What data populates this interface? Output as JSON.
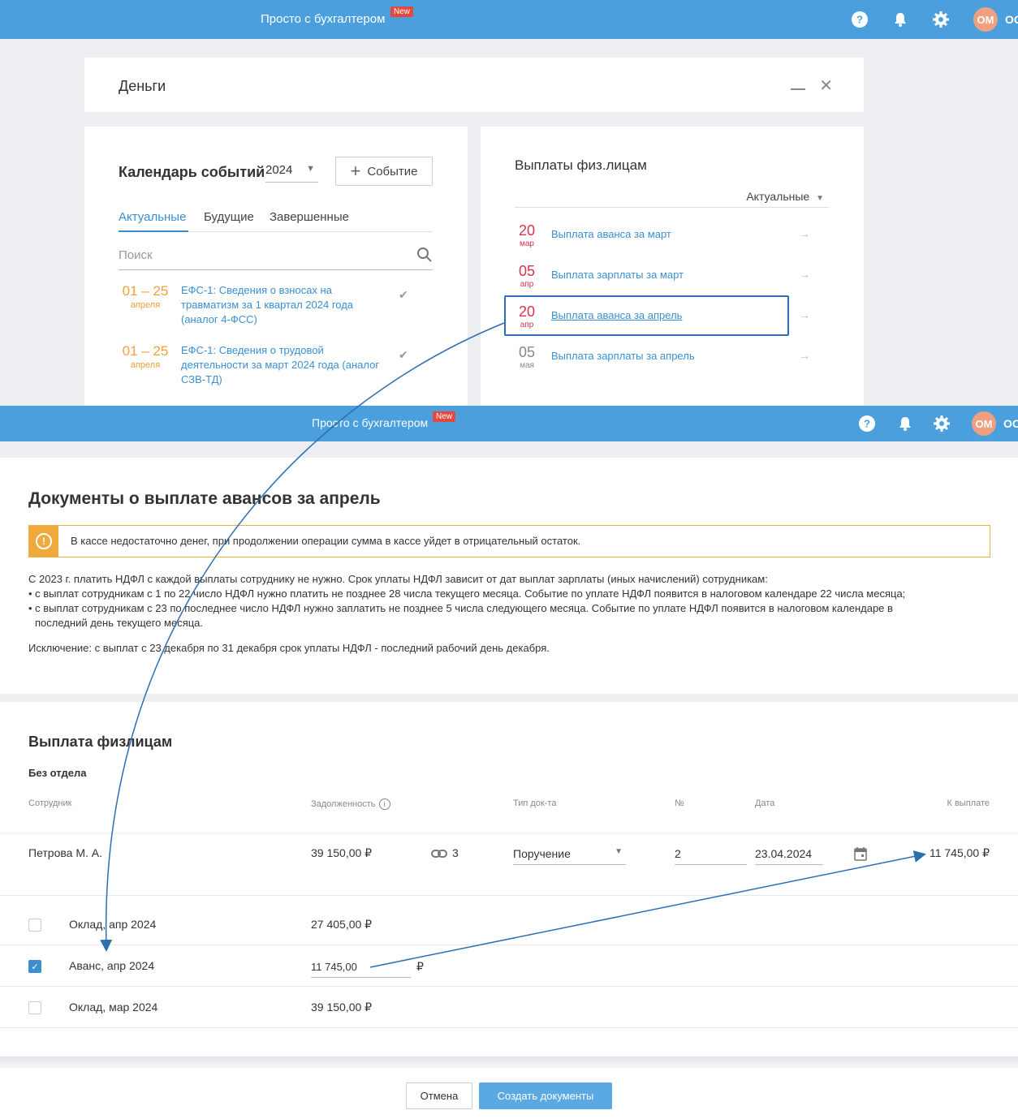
{
  "panel1": {
    "header": {
      "brand": "Просто с бухгалтером",
      "badge": "New",
      "avatar": "ОМ",
      "org": "OO"
    },
    "window_title": "Деньги",
    "calendar": {
      "title": "Календарь событий",
      "year": "2024",
      "event_button": "Событие",
      "tabs": [
        "Актуальные",
        "Будущие",
        "Завершенные"
      ],
      "search_placeholder": "Поиск",
      "events": [
        {
          "date": "01 – 25",
          "month": "апреля",
          "text": "ЕФС-1: Сведения о взносах на травматизм за 1 квартал 2024 года (аналог 4-ФСС)"
        },
        {
          "date": "01 – 25",
          "month": "апреля",
          "text": "ЕФС-1: Сведения о трудовой деятельности за март 2024 года (аналог СЗВ-ТД)"
        }
      ]
    },
    "payments": {
      "title": "Выплаты физ.лицам",
      "filter": "Актуальные",
      "items": [
        {
          "day": "20",
          "month": "мар",
          "text": "Выплата аванса за март"
        },
        {
          "day": "05",
          "month": "апр",
          "text": "Выплата зарплаты за март"
        },
        {
          "day": "20",
          "month": "апр",
          "text": "Выплата аванса за апрель"
        },
        {
          "day": "05",
          "month": "мая",
          "text": "Выплата зарплаты за апрель"
        }
      ]
    }
  },
  "panel2": {
    "header": {
      "brand": "Просто с бухгалтером",
      "badge": "New",
      "avatar": "ОМ",
      "org": "OO"
    },
    "title": "Документы о выплате авансов за апрель",
    "warning": "В кассе недостаточно денег, при продолжении операции сумма в кассе уйдет в отрицательный остаток.",
    "info_lines": [
      "С 2023 г. платить НДФЛ с каждой выплаты сотруднику не нужно. Срок уплаты НДФЛ зависит от дат выплат зарплаты (иных начислений) сотрудникам:",
      "• с выплат сотрудникам с 1 по 22 число НДФЛ нужно платить не позднее 28 числа текущего месяца. Событие по уплате НДФЛ появится в налоговом календаре 22 числа месяца;",
      "• с выплат сотрудникам с 23 по последнее число НДФЛ нужно заплатить не позднее 5 числа следующего месяца. Событие по уплате НДФЛ появится в налоговом календаре в",
      "последний день текущего месяца."
    ],
    "exception": "Исключение: с выплат с 23 декабря по 31 декабря срок уплаты НДФЛ - последний рабочий день декабря.",
    "section_title": "Выплата физлицам",
    "department": "Без отдела",
    "columns": {
      "employee": "Сотрудник",
      "debt": "Задолженность",
      "doc_type": "Тип док-та",
      "num": "№",
      "date": "Дата",
      "to_pay": "К выплате"
    },
    "employee": {
      "name": "Петрова М. А.",
      "debt": "39 150,00 ₽",
      "links": "3",
      "doc_type": "Поручение",
      "num": "2",
      "date": "23.04.2024",
      "to_pay": "11 745,00 ₽"
    },
    "accruals": [
      {
        "label": "Оклад, апр 2024",
        "value": "27 405,00 ₽",
        "checked": false
      },
      {
        "label": "Аванс, апр 2024",
        "value": "11 745,00",
        "currency": "₽",
        "checked": true
      },
      {
        "label": "Оклад, мар 2024",
        "value": "39 150,00 ₽",
        "checked": false
      }
    ],
    "buttons": {
      "cancel": "Отмена",
      "create": "Создать документы"
    }
  }
}
